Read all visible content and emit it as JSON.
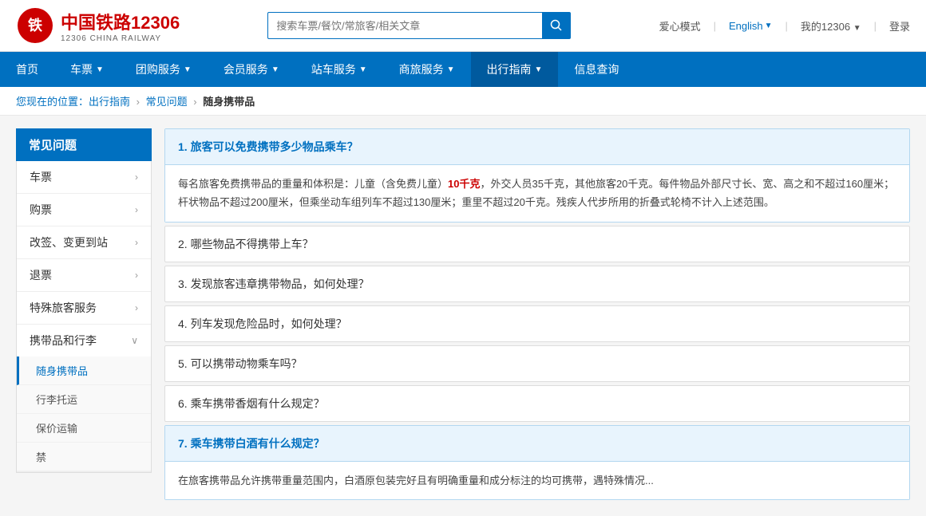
{
  "header": {
    "logo_title": "中国铁路12306",
    "logo_sub": "12306 CHINA RAILWAY",
    "search_placeholder": "搜索车票/餐饮/常旅客/相关文章",
    "love_mode": "爱心模式",
    "language": "English",
    "my_account": "我的12306",
    "login": "登录"
  },
  "nav": {
    "items": [
      {
        "label": "首页",
        "has_chevron": false
      },
      {
        "label": "车票",
        "has_chevron": true
      },
      {
        "label": "团购服务",
        "has_chevron": true
      },
      {
        "label": "会员服务",
        "has_chevron": true
      },
      {
        "label": "站车服务",
        "has_chevron": true
      },
      {
        "label": "商旅服务",
        "has_chevron": true
      },
      {
        "label": "出行指南",
        "has_chevron": true,
        "active": true
      },
      {
        "label": "信息查询",
        "has_chevron": false
      }
    ]
  },
  "breadcrumb": {
    "items": [
      {
        "label": "您现在的位置：出行指南",
        "link": true
      },
      {
        "label": "常见问题",
        "link": true
      },
      {
        "label": "随身携带品",
        "link": false
      }
    ]
  },
  "sidebar": {
    "header": "常见问题",
    "items": [
      {
        "label": "车票",
        "has_chevron": true,
        "expanded": false
      },
      {
        "label": "购票",
        "has_chevron": true,
        "expanded": false
      },
      {
        "label": "改签、变更到站",
        "has_chevron": true,
        "expanded": false
      },
      {
        "label": "退票",
        "has_chevron": true,
        "expanded": false
      },
      {
        "label": "特殊旅客服务",
        "has_chevron": true,
        "expanded": false
      },
      {
        "label": "携带品和行李",
        "has_chevron": true,
        "expanded": true,
        "sub_items": [
          {
            "label": "随身携带品",
            "active": true
          },
          {
            "label": "行李托运"
          },
          {
            "label": "保价运输"
          },
          {
            "label": "禁"
          }
        ]
      }
    ]
  },
  "faq": {
    "items": [
      {
        "id": 1,
        "question": "1. 旅客可以免费携带多少物品乘车？",
        "expanded": true,
        "answer": "每名旅客免费携带品的重量和体积是：儿童（含免费儿童）10千克，外交人员35千克，其他旅客20千克。每件物品外部尺寸长、宽、高之和不超过160厘米；杆状物品不超过200厘米，但乘坐动车组列车不超过130厘米；重里不超过20千克。残疾人代步所用的折叠式轮椅不计入上述范围。",
        "highlight_text": "10千克",
        "highlight_position": "children_weight"
      },
      {
        "id": 2,
        "question": "2. 哪些物品不得携带上车？",
        "expanded": false,
        "answer": ""
      },
      {
        "id": 3,
        "question": "3. 发现旅客违章携带物品，如何处理？",
        "expanded": false,
        "answer": ""
      },
      {
        "id": 4,
        "question": "4. 列车发现危险品时，如何处理？",
        "expanded": false,
        "answer": ""
      },
      {
        "id": 5,
        "question": "5. 可以携带动物乘车吗？",
        "expanded": false,
        "answer": ""
      },
      {
        "id": 6,
        "question": "6. 乘车携带香烟有什么规定？",
        "expanded": false,
        "answer": ""
      },
      {
        "id": 7,
        "question": "7. 乘车携带白酒有什么规定？",
        "expanded": true,
        "answer": "在旅客携带品允许携带重量范围内，白酒原包装完好且有明确重量和成分标注的均可携带，遇特殊情况..."
      }
    ]
  }
}
